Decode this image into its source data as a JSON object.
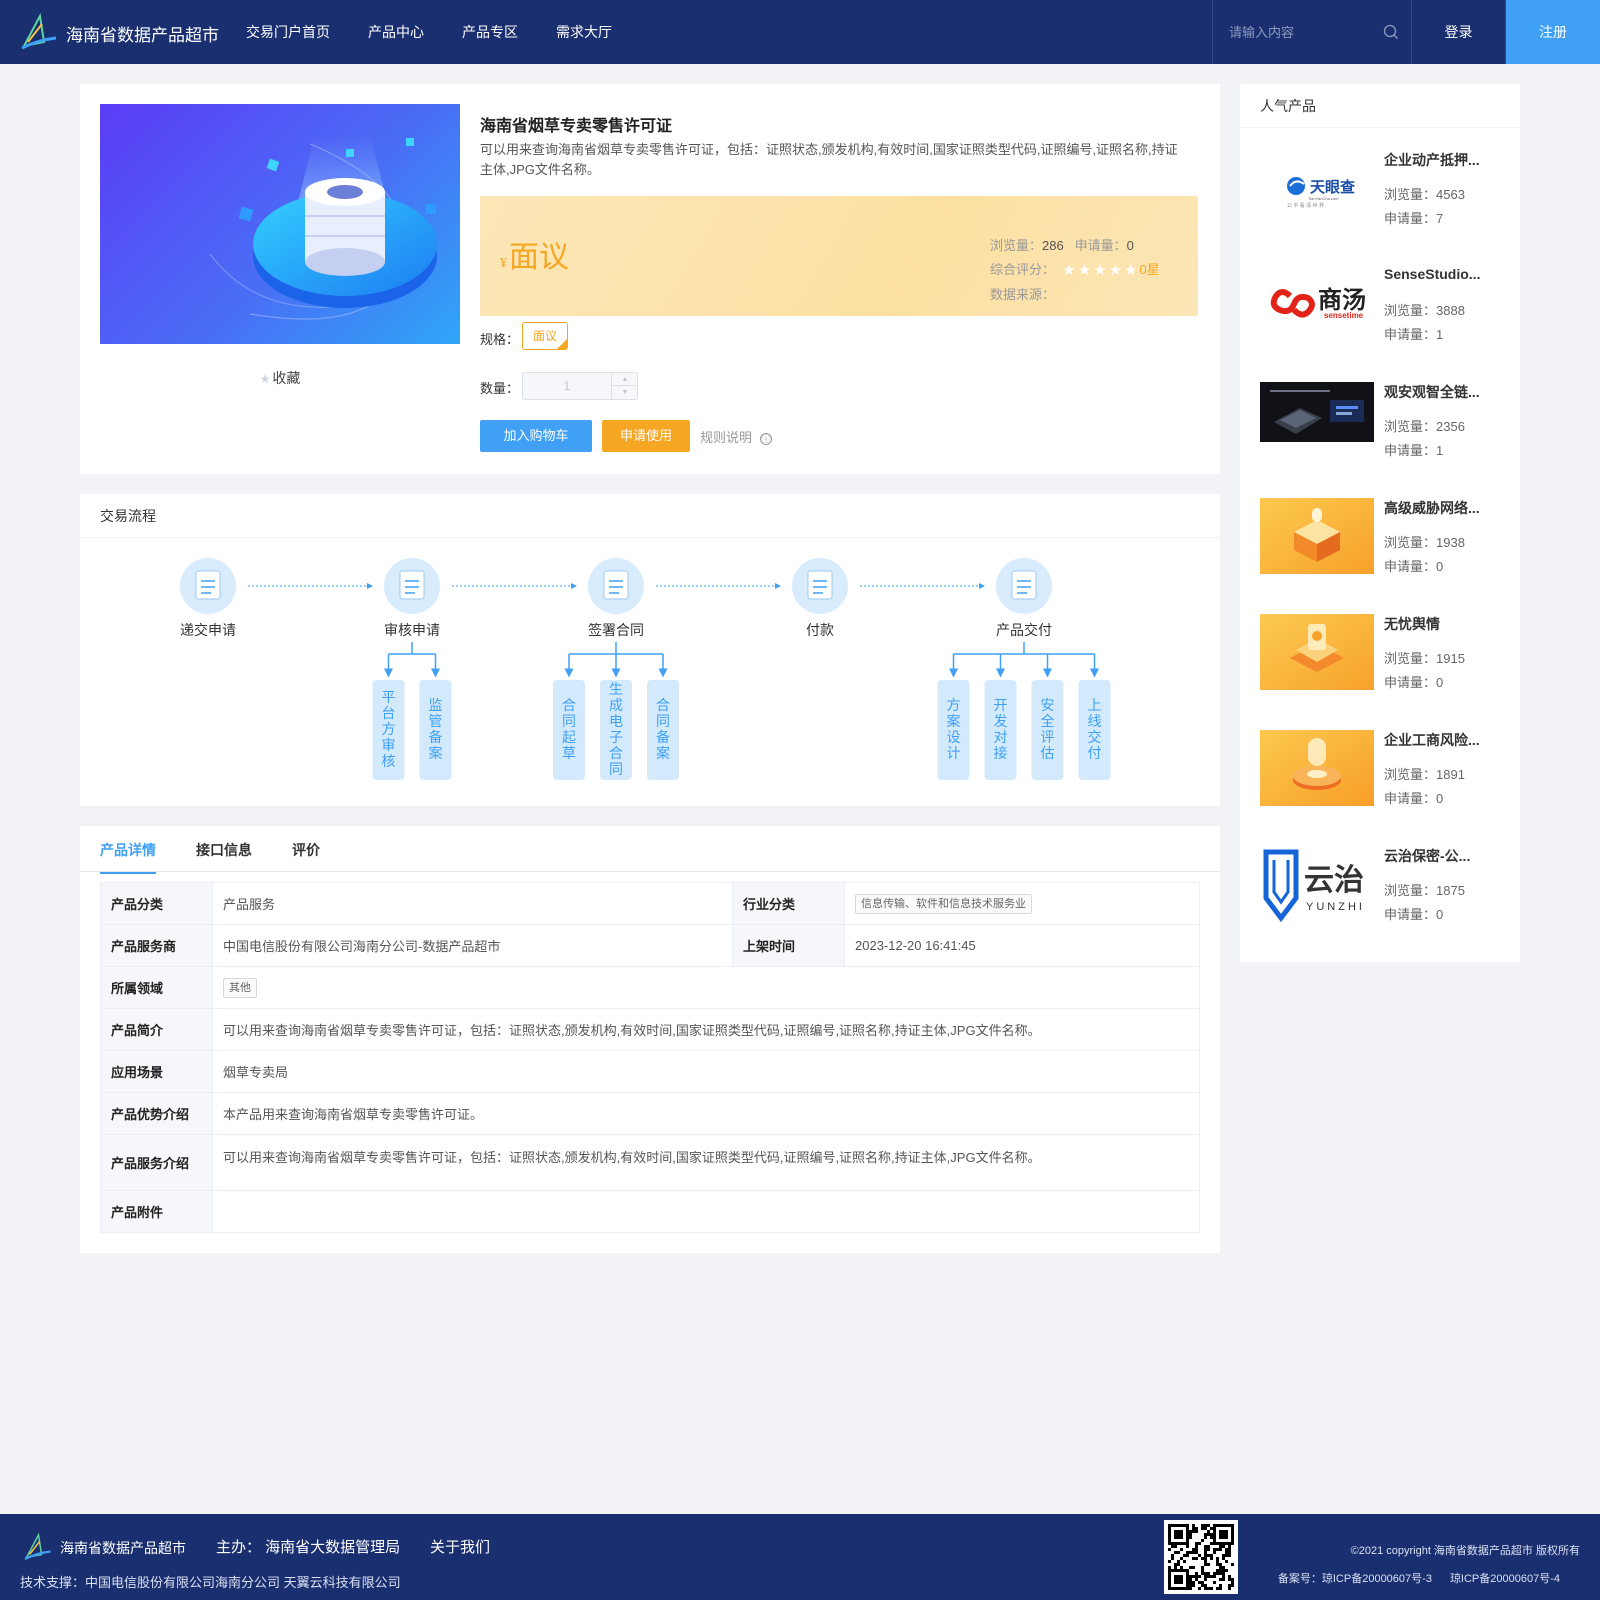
{
  "header": {
    "site_title": "海南省数据产品超市",
    "nav": [
      "交易门户首页",
      "产品中心",
      "产品专区",
      "需求大厅"
    ],
    "search_placeholder": "请输入内容",
    "login": "登录",
    "register": "注册"
  },
  "product": {
    "title": "海南省烟草专卖零售许可证",
    "description": "可以用来查询海南省烟草专卖零售许可证，包括：证照状态,颁发机构,有效时间,国家证照类型代码,证照编号,证照名称,持证主体,JPG文件名称。",
    "favorite": "收藏",
    "price_symbol": "¥",
    "price": "面议",
    "views_label": "浏览量：",
    "views": "286",
    "applications_label": "申请量：",
    "applications": "0",
    "rating_label": "综合评分：",
    "rating_stars": "★★★★★",
    "rating": "0星",
    "rating_value": 0,
    "source_label": "数据来源：",
    "spec_label": "规格：",
    "spec_value": "面议",
    "quantity_label": "数量：",
    "quantity": "1",
    "add_to_cart": "加入购物车",
    "apply": "申请使用",
    "rules": "规则说明",
    "info_icon": "ⓘ"
  },
  "process": {
    "title": "交易流程",
    "steps": [
      "递交申请",
      "审核申请",
      "签署合同",
      "付款",
      "产品交付"
    ],
    "substeps": {
      "review": [
        "平台方审核",
        "监管备案"
      ],
      "contract": [
        "合同起草",
        "生成电子合同",
        "合同备案"
      ],
      "delivery": [
        "方案设计",
        "开发对接",
        "安全评估",
        "上线交付"
      ]
    }
  },
  "details": {
    "tabs": [
      "产品详情",
      "接口信息",
      "评价"
    ],
    "active_tab": "产品详情",
    "rows": {
      "category_label": "产品分类",
      "category": "产品服务",
      "industry_label": "行业分类",
      "industry": "信息传输、软件和信息技术服务业",
      "provider_label": "产品服务商",
      "provider": "中国电信股份有限公司海南分公司-数据产品超市",
      "listed_label": "上架时间",
      "listed": "2023-12-20 16:41:45",
      "domain_label": "所属领域",
      "domain": "其他",
      "intro_label": "产品简介",
      "intro": "可以用来查询海南省烟草专卖零售许可证，包括：证照状态,颁发机构,有效时间,国家证照类型代码,证照编号,证照名称,持证主体,JPG文件名称。",
      "scenario_label": "应用场景",
      "scenario": "烟草专卖局",
      "advantage_label": "产品优势介绍",
      "advantage": "本产品用来查询海南省烟草专卖零售许可证。",
      "service_label": "产品服务介绍",
      "service": "可以用来查询海南省烟草专卖零售许可证，包括：证照状态,颁发机构,有效时间,国家证照类型代码,证照编号,证照名称,持证主体,JPG文件名称。",
      "attachment_label": "产品附件",
      "attachment": ""
    }
  },
  "popular": {
    "title": "人气产品",
    "views_label": "浏览量：",
    "applications_label": "申请量：",
    "items": [
      {
        "name": "企业动产抵押...",
        "views": "4563",
        "applications": "7",
        "logo": "天眼查",
        "logo_sub": "TianYanCha.com",
        "logo_tag": "公 平 看 清 世 界"
      },
      {
        "name": "SenseStudio...",
        "views": "3888",
        "applications": "1",
        "logo": "商汤",
        "logo_sub": "sensetime"
      },
      {
        "name": "观安观智全链...",
        "views": "2356",
        "applications": "1"
      },
      {
        "name": "高级威胁网络...",
        "views": "1938",
        "applications": "0"
      },
      {
        "name": "无忧舆情",
        "views": "1915",
        "applications": "0"
      },
      {
        "name": "企业工商风险...",
        "views": "1891",
        "applications": "0"
      },
      {
        "name": "云治保密-公...",
        "views": "1875",
        "applications": "0",
        "logo": "云治",
        "logo_sub": "YUNZHI"
      }
    ]
  },
  "footer": {
    "title": "海南省数据产品超市",
    "host": "主办：  海南省大数据管理局",
    "about": "关于我们",
    "support": "技术支撑：中国电信股份有限公司海南分公司     天翼云科技有限公司",
    "copyright": "©2021 copyright 海南省数据产品超市 版权所有",
    "icp1": "备案号：琼ICP备20000607号-3",
    "icp2": "琼ICP备20000607号-4"
  },
  "colors": {
    "header_bg": "#1a2f70",
    "accent_blue": "#3fa0f5",
    "accent_orange": "#f5a623",
    "page_bg": "#f1f3f6"
  },
  "icons": [
    "logo-icon",
    "search-icon",
    "star-icon",
    "info-icon",
    "flow-step-icon",
    "qr-code"
  ]
}
